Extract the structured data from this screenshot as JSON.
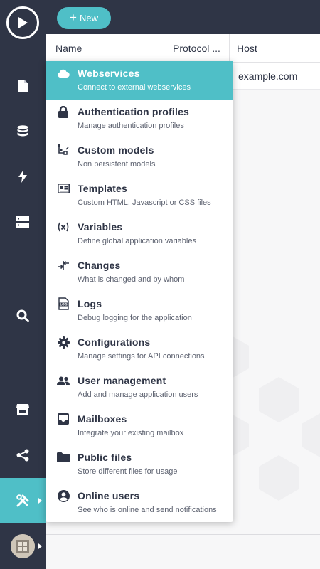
{
  "toolbar": {
    "new_label": "New"
  },
  "table": {
    "columns": [
      "Name",
      "Protocol ...",
      "Host"
    ],
    "rows": [
      {
        "host": "example.com"
      }
    ]
  },
  "sidebar": {
    "items": [
      {
        "icon": "play-logo-icon"
      },
      {
        "icon": "file-icon"
      },
      {
        "icon": "database-icon"
      },
      {
        "icon": "lightning-icon"
      },
      {
        "icon": "server-icon"
      },
      {
        "icon": "search-icon"
      },
      {
        "icon": "store-icon"
      },
      {
        "icon": "share-icon"
      },
      {
        "icon": "tools-icon",
        "active": true
      },
      {
        "icon": "avatar"
      }
    ]
  },
  "menu": {
    "items": [
      {
        "title": "Webservices",
        "subtitle": "Connect to external webservices",
        "icon": "cloud-icon",
        "active": true
      },
      {
        "title": "Authentication profiles",
        "subtitle": "Manage authentication profiles",
        "icon": "lock-icon"
      },
      {
        "title": "Custom models",
        "subtitle": "Non persistent models",
        "icon": "model-icon"
      },
      {
        "title": "Templates",
        "subtitle": "Custom HTML, Javascript or CSS files",
        "icon": "template-icon"
      },
      {
        "title": "Variables",
        "subtitle": "Define global application variables",
        "icon": "variable-icon"
      },
      {
        "title": "Changes",
        "subtitle": "What is changed and by whom",
        "icon": "changes-icon"
      },
      {
        "title": "Logs",
        "subtitle": "Debug logging for the application",
        "icon": "log-icon"
      },
      {
        "title": "Configurations",
        "subtitle": "Manage settings for API connections",
        "icon": "gear-icon"
      },
      {
        "title": "User management",
        "subtitle": "Add and manage application users",
        "icon": "users-icon"
      },
      {
        "title": "Mailboxes",
        "subtitle": "Integrate your existing mailbox",
        "icon": "inbox-icon"
      },
      {
        "title": "Public files",
        "subtitle": "Store different files for usage",
        "icon": "folder-icon"
      },
      {
        "title": "Online users",
        "subtitle": "See who is online and send notifications",
        "icon": "user-circle-icon"
      }
    ]
  },
  "colors": {
    "sidebar": "#2f3546",
    "accent": "#4fbfc7",
    "text": "#2f3546"
  }
}
